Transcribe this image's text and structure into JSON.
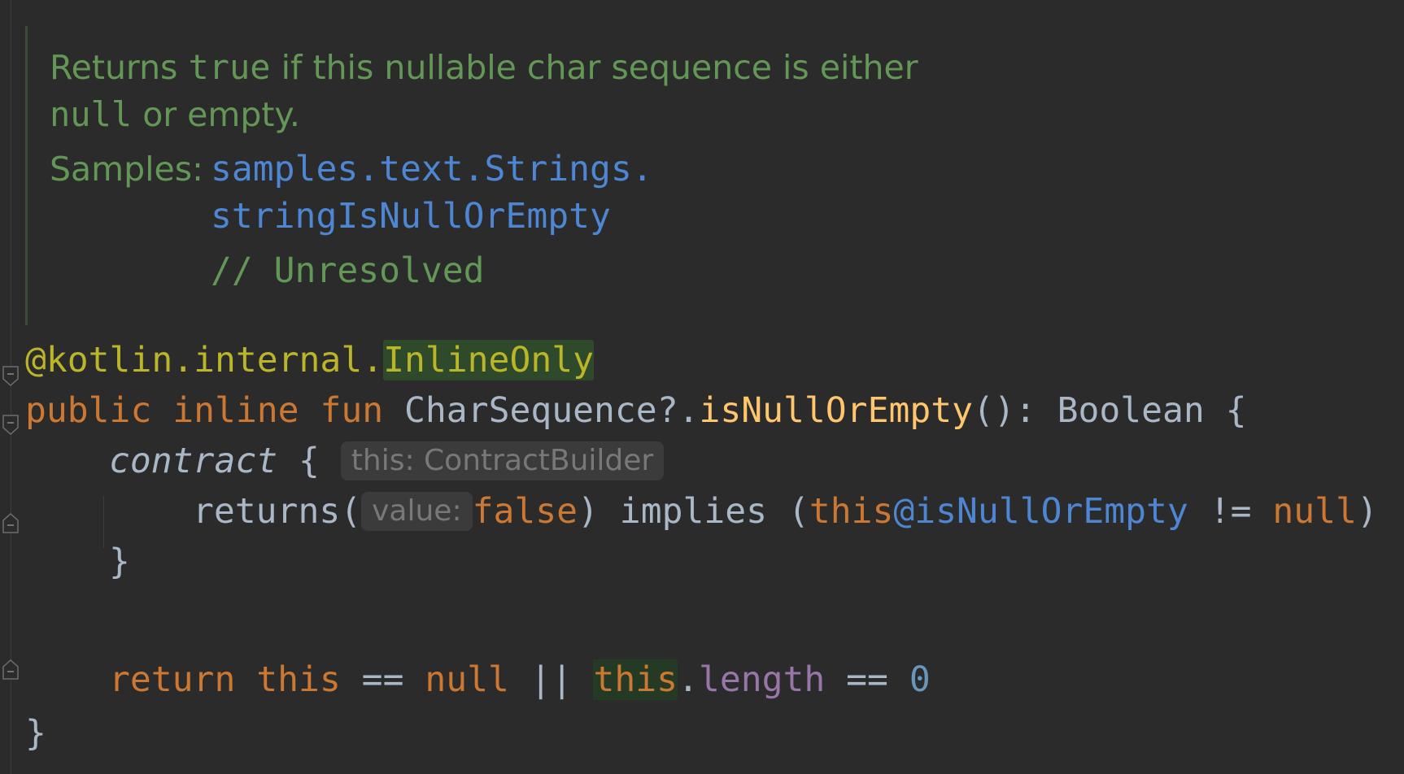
{
  "doc": {
    "summary_part1": "Returns ",
    "summary_true": "true",
    "summary_part2": " if this nullable char sequence is either",
    "summary_null": "null",
    "summary_part3": " or empty.",
    "samples_label": "Samples:",
    "samples_link_line1": "samples.text.Strings.",
    "samples_link_line2": "stringIsNullOrEmpty",
    "samples_comment": "// Unresolved"
  },
  "code": {
    "annotation_prefix": "@kotlin.internal.",
    "annotation_name": "InlineOnly",
    "kw_public": "public",
    "kw_inline": "inline",
    "kw_fun": "fun",
    "receiver_type": "CharSequence?.",
    "function_name": "isNullOrEmpty",
    "signature_rest": "(): Boolean {",
    "contract_call": "contract",
    "contract_brace": " {",
    "contract_hint": "this: ContractBuilder",
    "returns_call": "returns(",
    "returns_hint": "value:",
    "returns_false": "false",
    "implies_text": ") implies (",
    "this_kw": "this",
    "this_label": "@isNullOrEmpty",
    "not_equal": " != ",
    "null_kw": "null",
    "close_paren": ")",
    "inner_close_brace": "}",
    "kw_return": "return",
    "kw_this": "this",
    "eq_op": " == ",
    "kw_null": "null",
    "or_op": " || ",
    "kw_this2": "this",
    "dot": ".",
    "length_field": "length",
    "eq_op2": " == ",
    "zero": "0",
    "outer_close_brace": "}"
  },
  "icons": {
    "fold_open": "fold-open-icon",
    "fold_close": "fold-close-icon"
  },
  "colors": {
    "background": "#2b2b2b",
    "keyword": "#cc7832",
    "annotation": "#bbb529",
    "function": "#ffc66d",
    "doc_comment": "#629755",
    "link": "#4d86d3",
    "number": "#6897bb",
    "field": "#9876aa",
    "default_text": "#a9b7c6"
  }
}
